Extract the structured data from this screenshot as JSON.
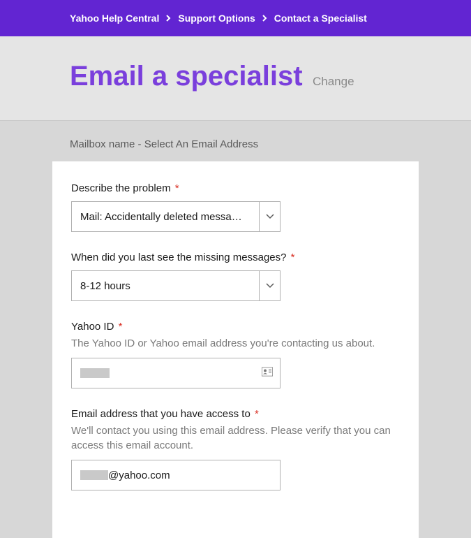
{
  "breadcrumb": {
    "items": [
      "Yahoo Help Central",
      "Support Options",
      "Contact a Specialist"
    ]
  },
  "header": {
    "title": "Email a specialist",
    "change_link": "Change"
  },
  "subheader": {
    "text": "Mailbox name - Select An Email Address"
  },
  "form": {
    "problem": {
      "label": "Describe the problem",
      "value": "Mail: Accidentally deleted messa…"
    },
    "lastseen": {
      "label": "When did you last see the missing messages?",
      "value": "8-12 hours"
    },
    "yahooid": {
      "label": "Yahoo ID",
      "help": "The Yahoo ID or Yahoo email address you're contacting us about."
    },
    "email": {
      "label": "Email address that you have access to",
      "help": "We'll contact you using this email address. Please verify that you can access this email account.",
      "domain": "@yahoo.com"
    }
  }
}
